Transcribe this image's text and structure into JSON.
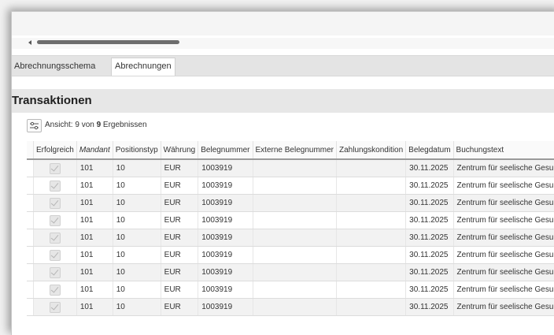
{
  "tabs": [
    {
      "label": "Abrechnungsschema",
      "active": false
    },
    {
      "label": "Abrechnungen",
      "active": true
    }
  ],
  "section": {
    "title": "Transaktionen"
  },
  "toolbar": {
    "filter_icon": "filter-sliders-icon",
    "view_prefix": "Ansicht: 9 von ",
    "view_total": "9",
    "view_suffix": " Ergebnissen"
  },
  "table": {
    "columns": [
      {
        "label": "Erfolgreich"
      },
      {
        "label": "Mandant"
      },
      {
        "label": "Positionstyp"
      },
      {
        "label": "Währung"
      },
      {
        "label": "Belegnummer"
      },
      {
        "label": "Externe Belegnummer"
      },
      {
        "label": "Zahlungskondition"
      },
      {
        "label": "Belegdatum"
      },
      {
        "label": "Buchungstext"
      }
    ],
    "rows": [
      {
        "erfolgreich": true,
        "mandant": "101",
        "positionstyp": "10",
        "waehrung": "EUR",
        "belegnummer": "1003919",
        "extern": "",
        "zahlung": "",
        "belegdatum": "30.11.2025",
        "buchungstext": "Zentrum für seelische Gesundheit"
      },
      {
        "erfolgreich": true,
        "mandant": "101",
        "positionstyp": "10",
        "waehrung": "EUR",
        "belegnummer": "1003919",
        "extern": "",
        "zahlung": "",
        "belegdatum": "30.11.2025",
        "buchungstext": "Zentrum für seelische Gesundheit"
      },
      {
        "erfolgreich": true,
        "mandant": "101",
        "positionstyp": "10",
        "waehrung": "EUR",
        "belegnummer": "1003919",
        "extern": "",
        "zahlung": "",
        "belegdatum": "30.11.2025",
        "buchungstext": "Zentrum für seelische Gesundheit"
      },
      {
        "erfolgreich": true,
        "mandant": "101",
        "positionstyp": "10",
        "waehrung": "EUR",
        "belegnummer": "1003919",
        "extern": "",
        "zahlung": "",
        "belegdatum": "30.11.2025",
        "buchungstext": "Zentrum für seelische Gesundheit"
      },
      {
        "erfolgreich": true,
        "mandant": "101",
        "positionstyp": "10",
        "waehrung": "EUR",
        "belegnummer": "1003919",
        "extern": "",
        "zahlung": "",
        "belegdatum": "30.11.2025",
        "buchungstext": "Zentrum für seelische Gesundheit"
      },
      {
        "erfolgreich": true,
        "mandant": "101",
        "positionstyp": "10",
        "waehrung": "EUR",
        "belegnummer": "1003919",
        "extern": "",
        "zahlung": "",
        "belegdatum": "30.11.2025",
        "buchungstext": "Zentrum für seelische Gesundheit"
      },
      {
        "erfolgreich": true,
        "mandant": "101",
        "positionstyp": "10",
        "waehrung": "EUR",
        "belegnummer": "1003919",
        "extern": "",
        "zahlung": "",
        "belegdatum": "30.11.2025",
        "buchungstext": "Zentrum für seelische Gesundheit"
      },
      {
        "erfolgreich": true,
        "mandant": "101",
        "positionstyp": "10",
        "waehrung": "EUR",
        "belegnummer": "1003919",
        "extern": "",
        "zahlung": "",
        "belegdatum": "30.11.2025",
        "buchungstext": "Zentrum für seelische Gesundheit"
      },
      {
        "erfolgreich": true,
        "mandant": "101",
        "positionstyp": "10",
        "waehrung": "EUR",
        "belegnummer": "1003919",
        "extern": "",
        "zahlung": "",
        "belegdatum": "30.11.2025",
        "buchungstext": "Zentrum für seelische Gesundheit"
      }
    ]
  },
  "colors": {
    "header_bar": "#e7e7e7",
    "row_alt": "#f2f2f2",
    "scroll_thumb": "#6d6d6d"
  }
}
